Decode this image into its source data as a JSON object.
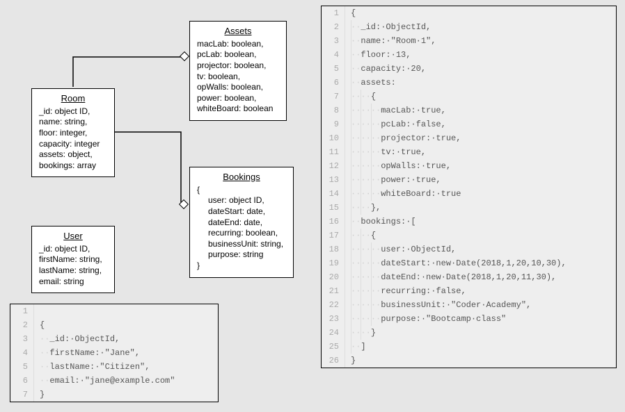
{
  "entities": {
    "assets": {
      "title": "Assets",
      "fields": [
        "macLab: boolean,",
        "pcLab: boolean,",
        "projector: boolean,",
        "tv: boolean,",
        "opWalls: boolean,",
        "power: boolean,",
        "whiteBoard: boolean"
      ]
    },
    "room": {
      "title": "Room",
      "fields": [
        "_id: object ID,",
        "name: string,",
        "floor: integer,",
        "capacity: integer",
        "assets: object,",
        "bookings: array"
      ]
    },
    "bookings": {
      "title": "Bookings",
      "lead": "{",
      "fields": [
        "user: object ID,",
        "dateStart: date,",
        "dateEnd: date,",
        "recurring: boolean,",
        "businessUnit: string,",
        "purpose: string"
      ],
      "tail": "}"
    },
    "user": {
      "title": "User",
      "fields": [
        "_id: object ID,",
        "firstName: string,",
        "lastName: string,",
        "email: string"
      ]
    }
  },
  "userCode": [
    "",
    "{",
    "··_id:·ObjectId,",
    "··firstName:·\"Jane\",",
    "··lastName:·\"Citizen\",",
    "··email:·\"jane@example.com\"",
    "}"
  ],
  "roomCode": [
    "{",
    "··_id:·ObjectId,",
    "··name:·\"Room·1\",",
    "··floor:·13,",
    "··capacity:·20,",
    "··assets:",
    "····{",
    "······macLab:·true,",
    "······pcLab:·false,",
    "······projector:·true,",
    "······tv:·true,",
    "······opWalls:·true,",
    "······power:·true,",
    "······whiteBoard:·true",
    "····},",
    "··bookings:·[",
    "····{",
    "······user:·ObjectId,",
    "······dateStart:·new·Date(2018,1,20,10,30),",
    "······dateEnd:·new·Date(2018,1,20,11,30),",
    "······recurring:·false,",
    "······businessUnit:·\"Coder·Academy\",",
    "······purpose:·\"Bootcamp·class\"",
    "····}",
    "··]",
    "}"
  ]
}
